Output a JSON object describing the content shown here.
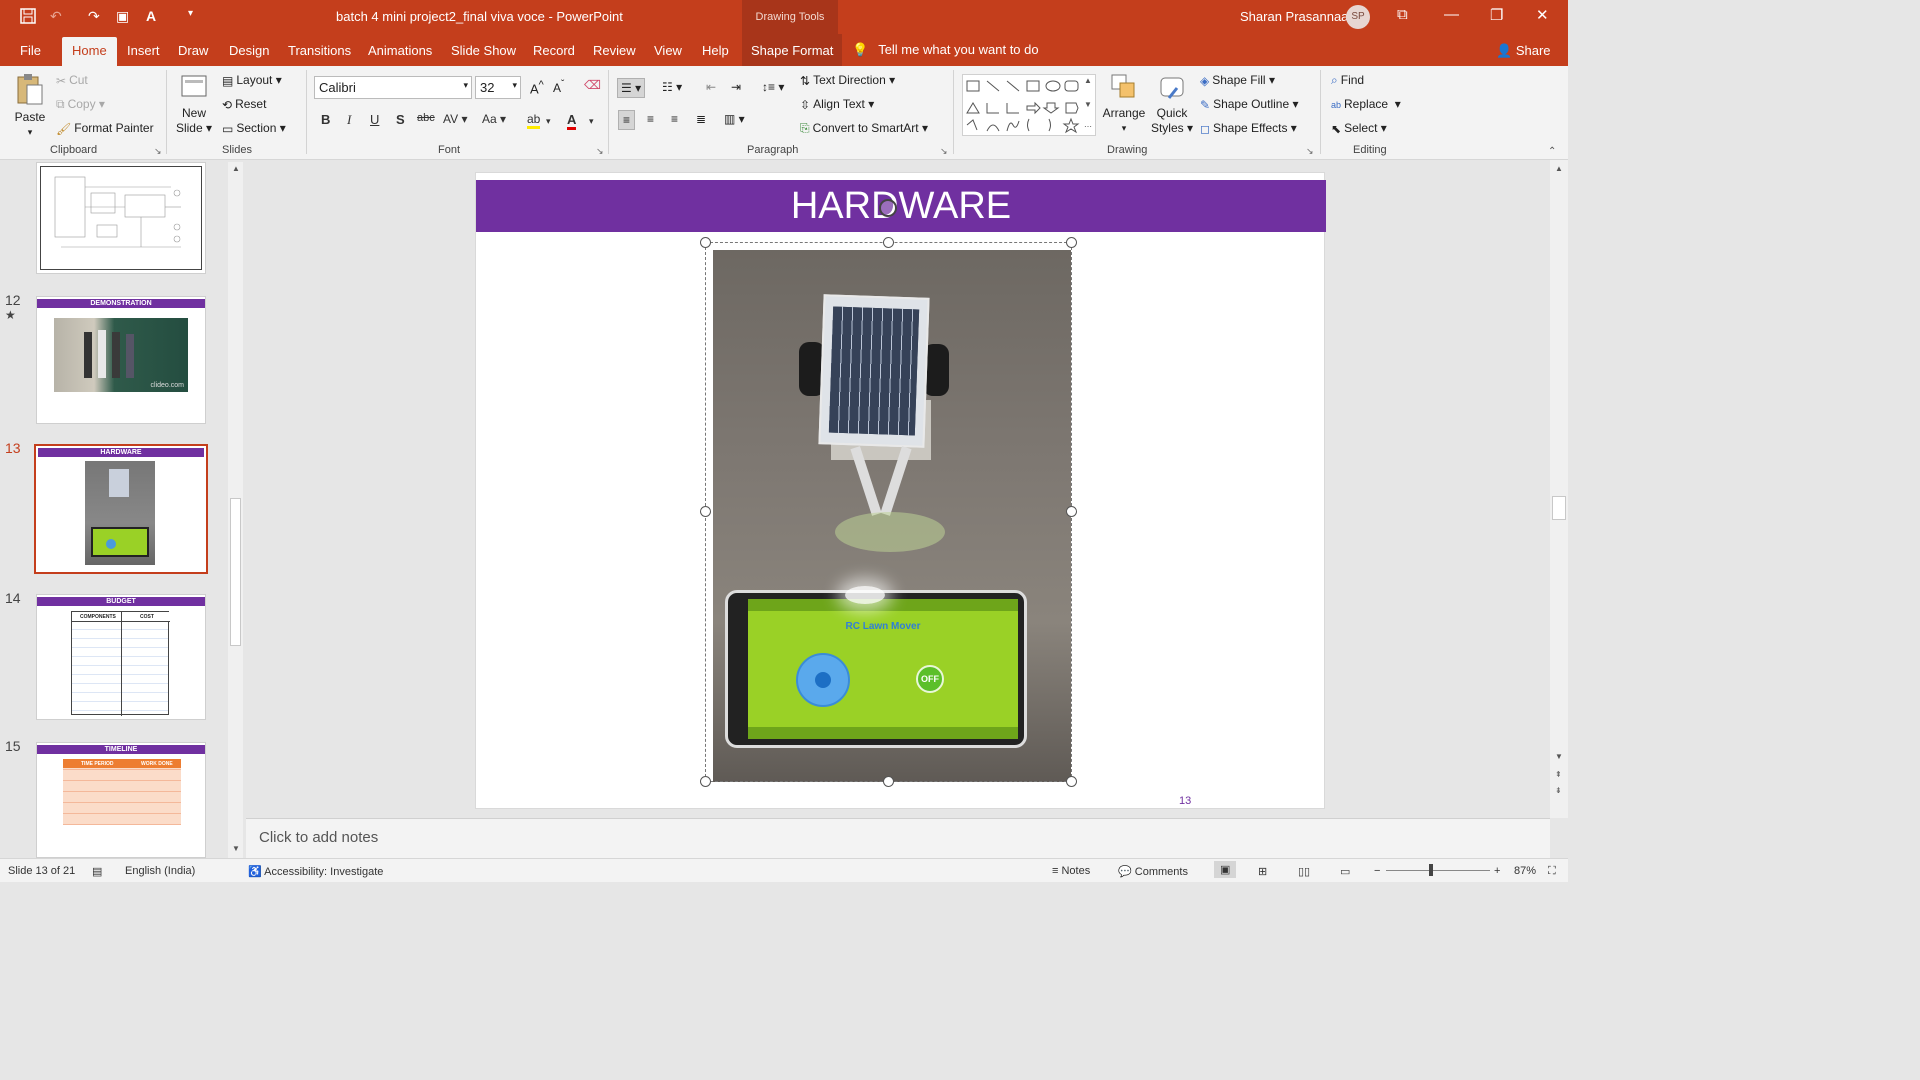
{
  "app": {
    "doc_title": "batch 4 mini project2_final viva voce  -  PowerPoint",
    "context_title": "Drawing Tools",
    "user_name": "Sharan Prasannaa",
    "user_initials": "SP"
  },
  "tabs": [
    "File",
    "Home",
    "Insert",
    "Draw",
    "Design",
    "Transitions",
    "Animations",
    "Slide Show",
    "Record",
    "Review",
    "View",
    "Help",
    "Shape Format"
  ],
  "tell_me": "Tell me what you want to do",
  "share_label": "Share",
  "ribbon": {
    "clipboard": {
      "paste": "Paste",
      "cut": "Cut",
      "copy": "Copy",
      "format_painter": "Format Painter",
      "label": "Clipboard"
    },
    "slides": {
      "new_slide_1": "New",
      "new_slide_2": "Slide",
      "layout": "Layout",
      "reset": "Reset",
      "section": "Section",
      "label": "Slides"
    },
    "font": {
      "name": "Calibri",
      "size": "32",
      "label": "Font"
    },
    "paragraph": {
      "text_direction": "Text Direction",
      "align_text": "Align Text",
      "convert": "Convert to SmartArt",
      "label": "Paragraph"
    },
    "drawing": {
      "arrange": "Arrange",
      "quick_1": "Quick",
      "quick_2": "Styles",
      "shape_fill": "Shape Fill",
      "shape_outline": "Shape Outline",
      "shape_effects": "Shape Effects",
      "label": "Drawing"
    },
    "editing": {
      "find": "Find",
      "replace": "Replace",
      "select": "Select",
      "label": "Editing"
    }
  },
  "thumbnails": [
    {
      "num": "",
      "title": ""
    },
    {
      "num": "12",
      "title": "DEMONSTRATION",
      "watermark": "clideo.com"
    },
    {
      "num": "13",
      "title": "HARDWARE"
    },
    {
      "num": "14",
      "title": "BUDGET",
      "table_header": [
        "COMPONENTS",
        "COST"
      ]
    },
    {
      "num": "15",
      "title": "TIMELINE",
      "table_header": [
        "TIME PERIOD",
        "WORK DONE"
      ]
    }
  ],
  "slide": {
    "title": "HARDWARE",
    "page_number": "13",
    "app_title": "RC Lawn Mover",
    "app_off": "OFF"
  },
  "notes_placeholder": "Click to add notes",
  "status": {
    "slide_info": "Slide 13 of 21",
    "language": "English (India)",
    "accessibility": "Accessibility: Investigate",
    "notes": "Notes",
    "comments": "Comments",
    "zoom": "87%"
  },
  "colors": {
    "accent": "#c43e1c",
    "slide_header": "#7030a0",
    "app_green": "#9ad126"
  }
}
